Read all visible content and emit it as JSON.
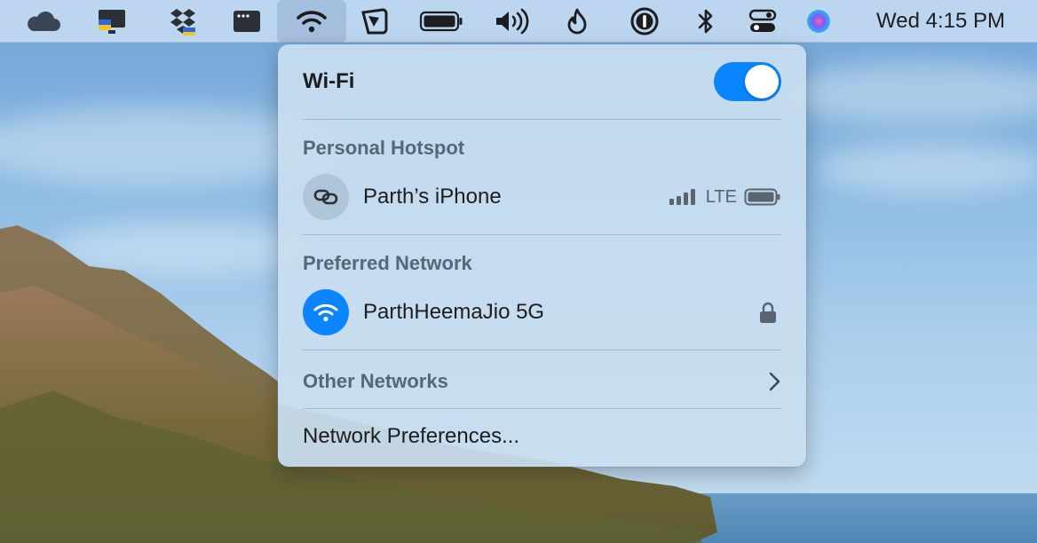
{
  "menubar": {
    "icons": [
      "cloud-icon",
      "display-icon",
      "dropbox-icon",
      "window-icon",
      "wifi-icon",
      "app-icon",
      "battery-icon",
      "volume-icon",
      "flame-icon",
      "onepassword-icon",
      "bluetooth-icon",
      "control-center-icon",
      "siri-icon"
    ],
    "clock": "Wed 4:15 PM"
  },
  "wifi_panel": {
    "title": "Wi-Fi",
    "enabled": true,
    "personal_hotspot": {
      "section_title": "Personal Hotspot",
      "device_name": "Parth’s iPhone",
      "network_type": "LTE"
    },
    "preferred_network": {
      "section_title": "Preferred Network",
      "ssid": "ParthHeemaJio 5G"
    },
    "other_networks_label": "Other Networks",
    "network_preferences_label": "Network Preferences..."
  },
  "colors": {
    "accent": "#0a84ff",
    "menubar": "#cde1f5",
    "panel": "#c8def0"
  }
}
